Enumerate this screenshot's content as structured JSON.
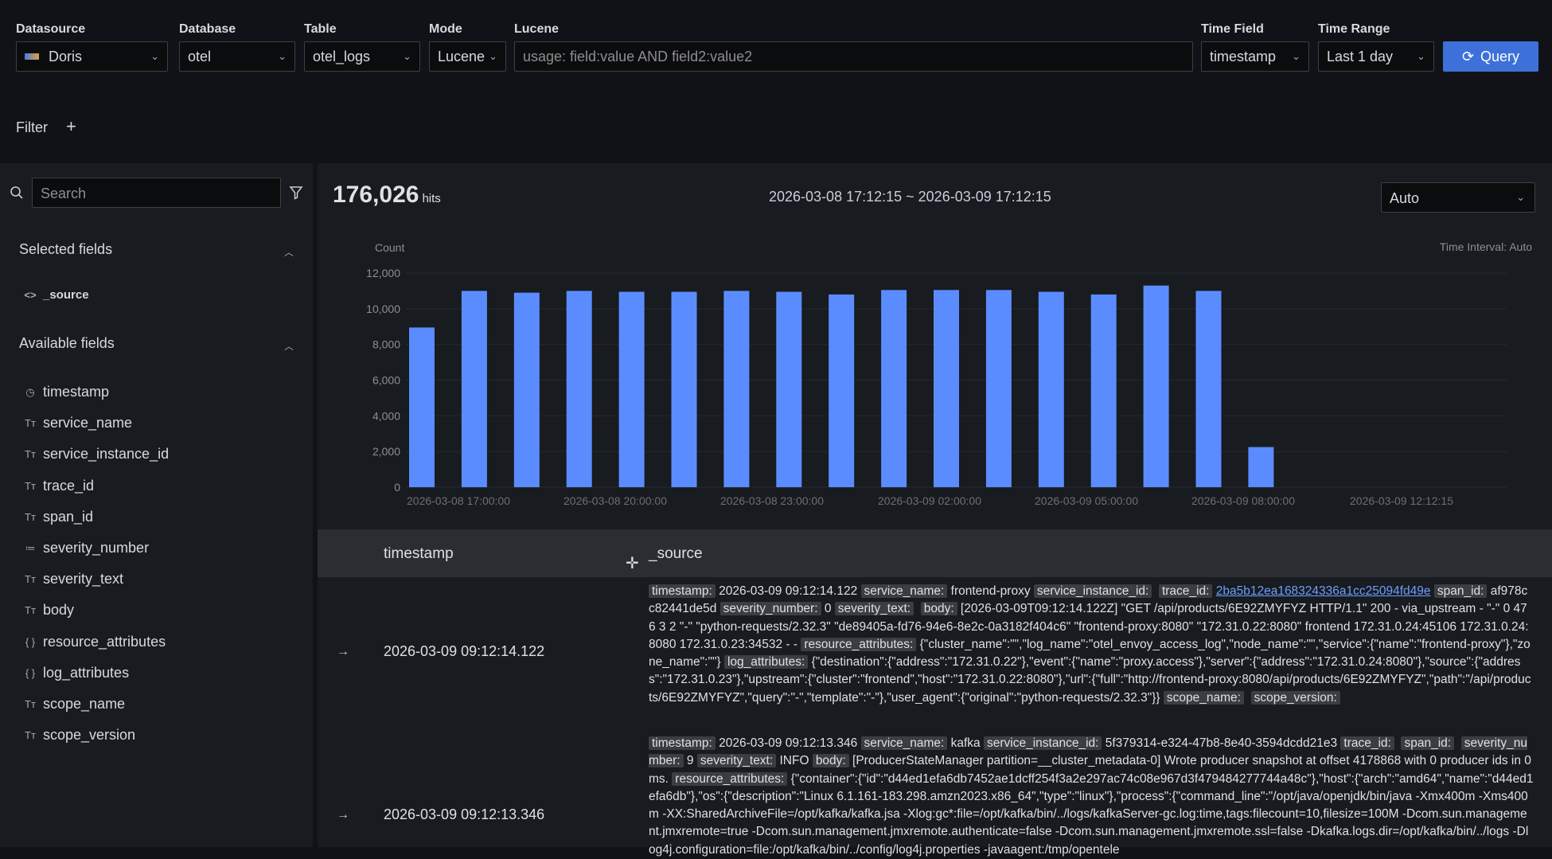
{
  "toolbar": {
    "datasource_label": "Datasource",
    "datasource_value": "Doris",
    "database_label": "Database",
    "database_value": "otel",
    "table_label": "Table",
    "table_value": "otel_logs",
    "mode_label": "Mode",
    "mode_value": "Lucene",
    "lucene_label": "Lucene",
    "lucene_placeholder": "usage: field:value AND field2:value2",
    "timefield_label": "Time Field",
    "timefield_value": "timestamp",
    "timerange_label": "Time Range",
    "timerange_value": "Last 1 day",
    "query_label": "Query",
    "filter_label": "Filter",
    "add_filter": "+"
  },
  "sidebar": {
    "search_placeholder": "Search",
    "selected_title": "Selected fields",
    "selected": [
      {
        "icon": "code-icon",
        "glyph": "<>",
        "name": "_source"
      }
    ],
    "available_title": "Available fields",
    "available": [
      {
        "icon": "clock-icon",
        "glyph": "◷",
        "name": "timestamp"
      },
      {
        "icon": "text-type-icon",
        "glyph": "Tт",
        "name": "service_name"
      },
      {
        "icon": "text-type-icon",
        "glyph": "Tт",
        "name": "service_instance_id"
      },
      {
        "icon": "text-type-icon",
        "glyph": "Tт",
        "name": "trace_id"
      },
      {
        "icon": "text-type-icon",
        "glyph": "Tт",
        "name": "span_id"
      },
      {
        "icon": "number-type-icon",
        "glyph": "≔",
        "name": "severity_number"
      },
      {
        "icon": "text-type-icon",
        "glyph": "Tт",
        "name": "severity_text"
      },
      {
        "icon": "text-type-icon",
        "glyph": "Tт",
        "name": "body"
      },
      {
        "icon": "object-type-icon",
        "glyph": "{ }",
        "name": "resource_attributes"
      },
      {
        "icon": "object-type-icon",
        "glyph": "{ }",
        "name": "log_attributes"
      },
      {
        "icon": "text-type-icon",
        "glyph": "Tт",
        "name": "scope_name"
      },
      {
        "icon": "text-type-icon",
        "glyph": "Tт",
        "name": "scope_version"
      }
    ]
  },
  "summary": {
    "hits": "176,026",
    "hits_unit": "hits",
    "range": "2026-03-08 17:12:15 ~ 2026-03-09 17:12:15",
    "interval_select": "Auto",
    "interval_note": "Time Interval: Auto"
  },
  "chart_data": {
    "type": "bar",
    "ylabel": "Count",
    "ylim": [
      0,
      12000
    ],
    "yticks": [
      "0",
      "2,000",
      "4,000",
      "6,000",
      "8,000",
      "10,000",
      "12,000"
    ],
    "xticks": [
      "2026-03-08 17:00:00",
      "2026-03-08 20:00:00",
      "2026-03-08 23:00:00",
      "2026-03-09 02:00:00",
      "2026-03-09 05:00:00",
      "2026-03-09 08:00:00",
      "2026-03-09 12:12:15"
    ],
    "categories": [
      "2026-03-08 17:00",
      "2026-03-08 18:00",
      "2026-03-08 19:00",
      "2026-03-08 20:00",
      "2026-03-08 21:00",
      "2026-03-08 22:00",
      "2026-03-08 23:00",
      "2026-03-09 00:00",
      "2026-03-09 01:00",
      "2026-03-09 02:00",
      "2026-03-09 03:00",
      "2026-03-09 04:00",
      "2026-03-09 05:00",
      "2026-03-09 06:00",
      "2026-03-09 07:00",
      "2026-03-09 08:00",
      "2026-03-09 09:00"
    ],
    "values": [
      8950,
      11000,
      10900,
      11000,
      10950,
      10950,
      11000,
      10950,
      10800,
      11050,
      11050,
      11050,
      10950,
      10800,
      11300,
      11000,
      2250
    ],
    "color": "#5b8cff",
    "grid": true
  },
  "table": {
    "col_timestamp": "timestamp",
    "col_source": "_source",
    "rows": [
      {
        "timestamp": "2026-03-09 09:12:14.122",
        "source_html": "<span class=\"k\">timestamp:</span> 2026-03-09 09:12:14.122 <span class=\"k\">service_name:</span> frontend-proxy <span class=\"k\">service_instance_id:</span>&nbsp; <span class=\"k\">trace_id:</span> <span class=\"lnk\">2ba5b12ea168324336a1cc25094fd49e</span> <span class=\"k\">span_id:</span> af978cc82441de5d <span class=\"k\">severity_number:</span> 0 <span class=\"k\">severity_text:</span>&nbsp; <span class=\"k\">body:</span> [2026-03-09T09:12:14.122Z] \"GET /api/products/6E92ZMYFYZ HTTP/1.1\" 200 - via_upstream - \"-\" 0 476 3 2 \"-\" \"python-requests/2.32.3\" \"de89405a-fd76-94e6-8e2c-0a3182f404c6\" \"frontend-proxy:8080\" \"172.31.0.22:8080\" frontend 172.31.0.24:45106 172.31.0.24:8080 172.31.0.23:34532 - - <span class=\"k\">resource_attributes:</span> {\"cluster_name\":\"\",\"log_name\":\"otel_envoy_access_log\",\"node_name\":\"\",\"service\":{\"name\":\"frontend-proxy\"},\"zone_name\":\"\"} <span class=\"k\">log_attributes:</span> {\"destination\":{\"address\":\"172.31.0.22\"},\"event\":{\"name\":\"proxy.access\"},\"server\":{\"address\":\"172.31.0.24:8080\"},\"source\":{\"address\":\"172.31.0.23\"},\"upstream\":{\"cluster\":\"frontend\",\"host\":\"172.31.0.22:8080\"},\"url\":{\"full\":\"http://frontend-proxy:8080/api/products/6E92ZMYFYZ\",\"path\":\"/api/products/6E92ZMYFYZ\",\"query\":\"-\",\"template\":\"-\"},\"user_agent\":{\"original\":\"python-requests/2.32.3\"}} <span class=\"k\">scope_name:</span>&nbsp; <span class=\"k\">scope_version:</span>"
      },
      {
        "timestamp": "2026-03-09 09:12:13.346",
        "source_html": "<span class=\"k\">timestamp:</span> 2026-03-09 09:12:13.346 <span class=\"k\">service_name:</span> kafka <span class=\"k\">service_instance_id:</span> 5f379314-e324-47b8-8e40-3594dcdd21e3 <span class=\"k\">trace_id:</span>&nbsp; <span class=\"k\">span_id:</span>&nbsp; <span class=\"k\">severity_number:</span> 9 <span class=\"k\">severity_text:</span> INFO <span class=\"k\">body:</span> [ProducerStateManager partition=__cluster_metadata-0] Wrote producer snapshot at offset 4178868 with 0 producer ids in 0 ms. <span class=\"k\">resource_attributes:</span> {\"container\":{\"id\":\"d44ed1efa6db7452ae1dcff254f3a2e297ac74c08e967d3f479484277744a48c\"},\"host\":{\"arch\":\"amd64\",\"name\":\"d44ed1efa6db\"},\"os\":{\"description\":\"Linux 6.1.161-183.298.amzn2023.x86_64\",\"type\":\"linux\"},\"process\":{\"command_line\":\"/opt/java/openjdk/bin/java -Xmx400m -Xms400m -XX:SharedArchiveFile=/opt/kafka/kafka.jsa -Xlog:gc*:file=/opt/kafka/bin/../logs/kafkaServer-gc.log:time,tags:filecount=10,filesize=100M -Dcom.sun.management.jmxremote=true -Dcom.sun.management.jmxremote.authenticate=false -Dcom.sun.management.jmxremote.ssl=false -Dkafka.logs.dir=/opt/kafka/bin/../logs -Dlog4j.configuration=file:/opt/kafka/bin/../config/log4j.properties -javaagent:/tmp/opentele"
      }
    ]
  }
}
